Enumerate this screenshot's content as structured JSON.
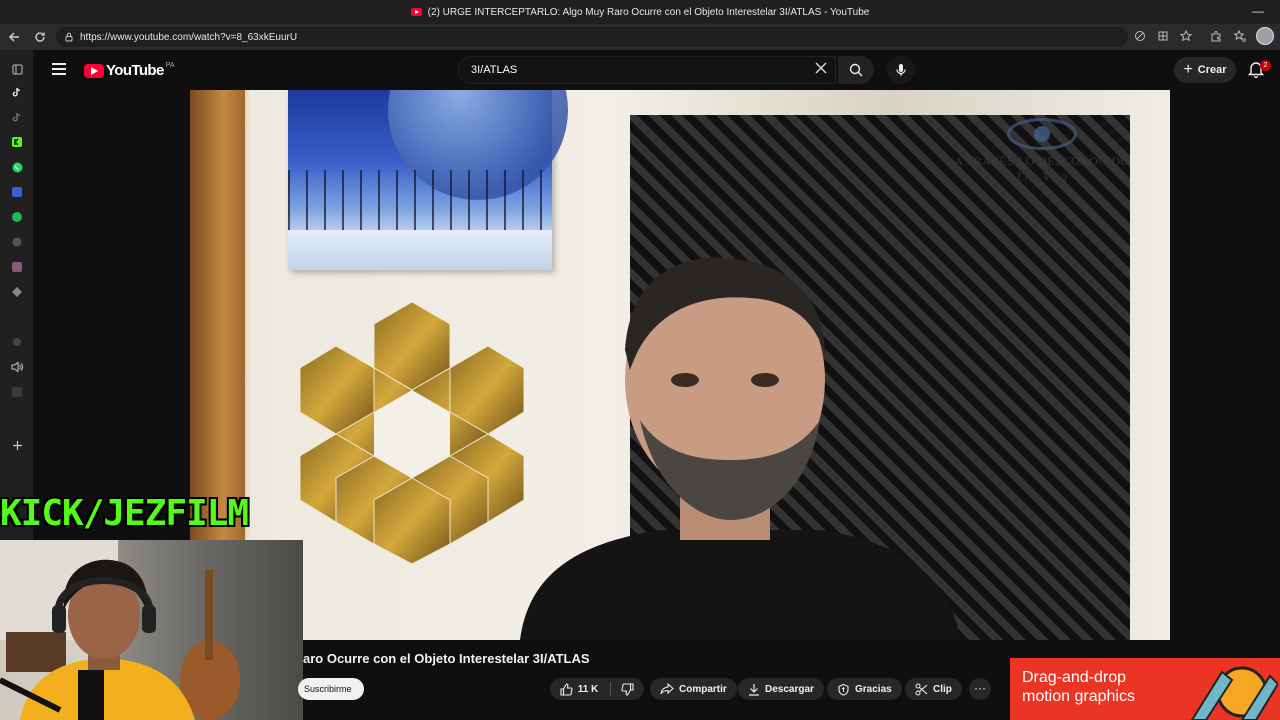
{
  "window": {
    "title": "(2) URGE INTERCEPTARLO: Algo Muy Raro Ocurre con el Objeto Interestelar 3I/ATLAS - YouTube",
    "minimize": "—"
  },
  "browser": {
    "url": "https://www.youtube.com/watch?v=8_63xkEuurU",
    "nav_icons": [
      "back-arrow-icon",
      "reload-icon",
      "lock-icon"
    ],
    "toolbar_icons": [
      "translate-icon",
      "apps-icon",
      "star-icon",
      "extensions-icon",
      "favorites-icon",
      "profile-avatar"
    ],
    "sidebar_icons": [
      "tabs-icon",
      "tiktok-icon",
      "tiktok-icon",
      "kick-icon",
      "whatsapp-icon",
      "app-icon",
      "spotify-icon",
      "app-icon",
      "app-icon",
      "app-icon",
      "app-icon",
      "speaker-icon",
      "app-icon",
      "add-icon"
    ]
  },
  "youtube": {
    "logo_text": "YouTube",
    "country_code": "PA",
    "search_query": "3I/ATLAS",
    "create_label": "Crear",
    "notifications_count": "2"
  },
  "video": {
    "watermark_line1": "A TRAVÉS LO DESCONOCIDO",
    "watermark_line2": "Live Vlog",
    "title_visible": "aro Ocurre con el Objeto Interestelar 3I/ATLAS",
    "subscribe_label": "Suscribirme",
    "likes": "11 K",
    "share_label": "Compartir",
    "download_label": "Descargar",
    "thanks_label": "Gracias",
    "clip_label": "Clip",
    "more_label": "···"
  },
  "overlay": {
    "kick_text": "KICK/JEZFILM"
  },
  "ad": {
    "line1": "Drag-and-drop",
    "line2": "motion graphics"
  },
  "colors": {
    "youtube_red": "#ff0033",
    "kick_green": "#53fc18",
    "ad_red": "#ea3524",
    "page_bg": "#0f0f0f"
  }
}
